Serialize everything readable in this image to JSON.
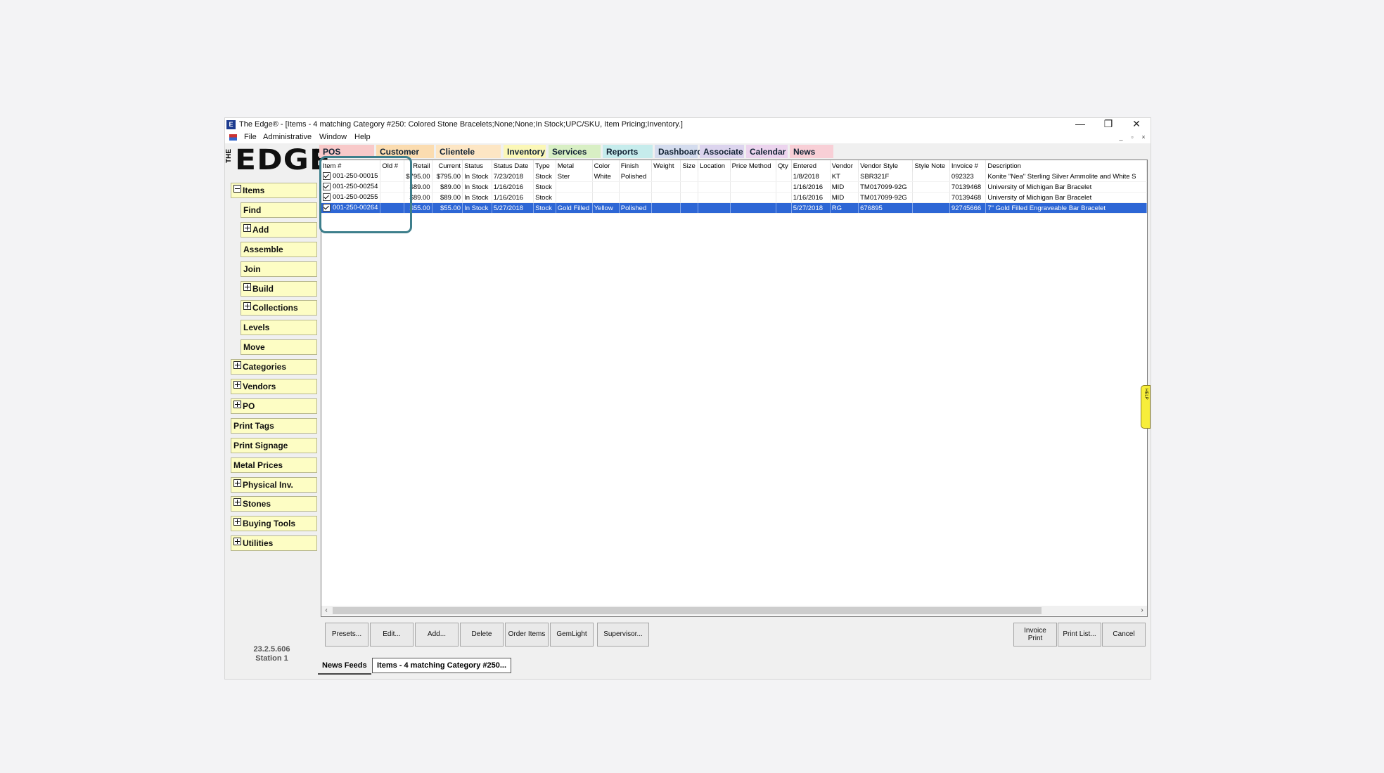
{
  "window": {
    "title": "The Edge® - [Items - 4 matching Category #250: Colored Stone Bracelets;None;None;In Stock;UPC/SKU, Item Pricing;Inventory.]",
    "app_icon": "E",
    "min": "—",
    "max": "❐",
    "close": "✕"
  },
  "menu": [
    "File",
    "Administrative",
    "Window",
    "Help"
  ],
  "mdi": {
    "min": "_",
    "restore": "▫",
    "close": "×"
  },
  "logo": {
    "the": "THE",
    "edge": "EDGE",
    "reg": "®"
  },
  "tabs": [
    {
      "label": "POS",
      "color": "#f8c9c9"
    },
    {
      "label": "Customer",
      "color": "#fbdcb0"
    },
    {
      "label": "Clientele",
      "color": "#fde6c4"
    },
    {
      "label": "Inventory",
      "color": "#fbf7b7"
    },
    {
      "label": "Services",
      "color": "#d8efc4"
    },
    {
      "label": "Reports",
      "color": "#c6ecec"
    },
    {
      "label": "Dashboards",
      "color": "#d4dcee"
    },
    {
      "label": "Associate",
      "color": "#dcd4ee"
    },
    {
      "label": "Calendar",
      "color": "#ecd4ee"
    },
    {
      "label": "News",
      "color": "#f8cfd6"
    }
  ],
  "sidebar": [
    {
      "label": "Items",
      "icon": "minus",
      "indent": 0
    },
    {
      "label": "Find",
      "icon": "",
      "indent": 1
    },
    {
      "label": "Add",
      "icon": "plus",
      "indent": 1
    },
    {
      "label": "Assemble",
      "icon": "",
      "indent": 1
    },
    {
      "label": "Join",
      "icon": "",
      "indent": 1
    },
    {
      "label": "Build",
      "icon": "plus",
      "indent": 1
    },
    {
      "label": "Collections",
      "icon": "plus",
      "indent": 1
    },
    {
      "label": "Levels",
      "icon": "",
      "indent": 1
    },
    {
      "label": "Move",
      "icon": "",
      "indent": 1
    },
    {
      "label": "Categories",
      "icon": "plus",
      "indent": 0
    },
    {
      "label": "Vendors",
      "icon": "plus",
      "indent": 0
    },
    {
      "label": "PO",
      "icon": "plus",
      "indent": 0
    },
    {
      "label": "Print Tags",
      "icon": "",
      "indent": 0
    },
    {
      "label": "Print Signage",
      "icon": "",
      "indent": 0
    },
    {
      "label": "Metal Prices",
      "icon": "",
      "indent": 0
    },
    {
      "label": "Physical Inv.",
      "icon": "plus",
      "indent": 0
    },
    {
      "label": "Stones",
      "icon": "plus",
      "indent": 0
    },
    {
      "label": "Buying Tools",
      "icon": "plus",
      "indent": 0
    },
    {
      "label": "Utilities",
      "icon": "plus",
      "indent": 0
    }
  ],
  "version": "23.2.5.606",
  "station": "Station 1",
  "table": {
    "columns": [
      "Item #",
      "Old #",
      "Retail",
      "Current",
      "Status",
      "Status Date",
      "Type",
      "Metal",
      "Color",
      "Finish",
      "Weight",
      "Size",
      "Location",
      "Price Method",
      "Qty",
      "Entered",
      "Vendor",
      "Vendor Style",
      "Style Note",
      "Invoice #",
      "Description"
    ],
    "rows": [
      {
        "selected": false,
        "cells": [
          "001-250-00015",
          "",
          "$795.00",
          "$795.00",
          "In Stock",
          "7/23/2018",
          "Stock",
          "Ster",
          "White",
          "Polished",
          "",
          "",
          "",
          "",
          "",
          "1/8/2018",
          "KT",
          "SBR321F",
          "",
          "092323",
          "Konite \"Nea\" Sterling Silver Ammolite and White S"
        ]
      },
      {
        "selected": false,
        "cells": [
          "001-250-00254",
          "",
          "$89.00",
          "$89.00",
          "In Stock",
          "1/16/2016",
          "Stock",
          "",
          "",
          "",
          "",
          "",
          "",
          "",
          "",
          "1/16/2016",
          "MID",
          "TM017099-92G",
          "",
          "70139468",
          "University of Michigan Bar Bracelet"
        ]
      },
      {
        "selected": false,
        "cells": [
          "001-250-00255",
          "",
          "$89.00",
          "$89.00",
          "In Stock",
          "1/16/2016",
          "Stock",
          "",
          "",
          "",
          "",
          "",
          "",
          "",
          "",
          "1/16/2016",
          "MID",
          "TM017099-92G",
          "",
          "70139468",
          "University of Michigan Bar Bracelet"
        ]
      },
      {
        "selected": true,
        "cells": [
          "001-250-00264",
          "",
          "$55.00",
          "$55.00",
          "In Stock",
          "5/27/2018",
          "Stock",
          "Gold Filled",
          "Yellow",
          "Polished",
          "",
          "",
          "",
          "",
          "",
          "5/27/2018",
          "RG",
          "676895",
          "",
          "92745666",
          "7\" Gold Filled Engraveable Bar Bracelet"
        ]
      }
    ]
  },
  "scroll": {
    "left": "‹",
    "right": "›"
  },
  "help_tab": "HELP",
  "buttons": {
    "presets": "Presets...",
    "edit": "Edit...",
    "add": "Add...",
    "delete": "Delete",
    "order_items": "Order Items",
    "gemlight": "GemLight",
    "supervisor": "Supervisor...",
    "invoice_print_1": "Invoice",
    "invoice_print_2": "Print",
    "print_list": "Print List...",
    "cancel": "Cancel"
  },
  "bottom_tabs": [
    "News Feeds",
    "Items - 4 matching Category #250..."
  ]
}
